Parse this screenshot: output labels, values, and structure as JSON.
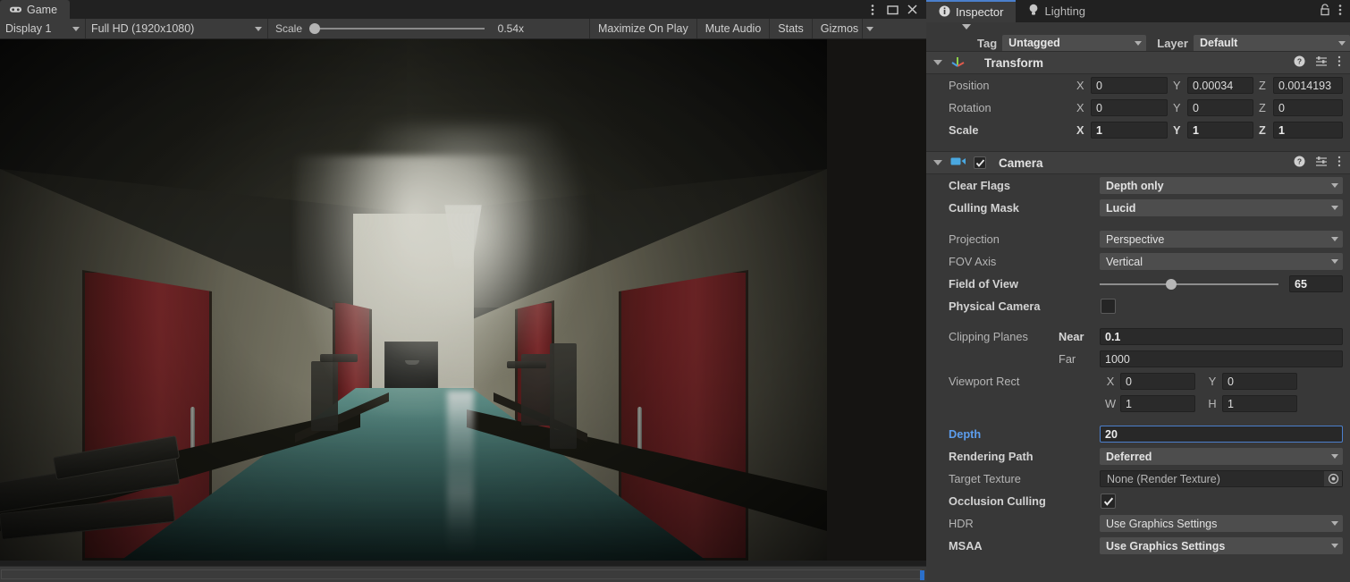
{
  "game_panel": {
    "tab": {
      "label": "Game",
      "icon": "gamepad-icon"
    },
    "window_buttons": [
      {
        "name": "kebab-menu-icon",
        "glyph": "⋮"
      },
      {
        "name": "maximize-icon",
        "glyph": "□"
      },
      {
        "name": "close-icon",
        "glyph": "✕"
      }
    ],
    "toolbar": {
      "display": "Display 1",
      "resolution": "Full HD (1920x1080)",
      "scale_label": "Scale",
      "scale_value": "0.54x",
      "maximize_on_play": "Maximize On Play",
      "mute_audio": "Mute Audio",
      "stats": "Stats",
      "gizmos": "Gizmos"
    }
  },
  "inspector": {
    "tabs": [
      {
        "label": "Inspector",
        "icon": "info-icon",
        "active": true
      },
      {
        "label": "Lighting",
        "icon": "lightbulb-icon",
        "active": false
      }
    ],
    "tab_icons": [
      {
        "name": "lock-icon",
        "glyph": "⏏"
      },
      {
        "name": "kebab-menu-icon",
        "glyph": "⋮"
      }
    ],
    "tag_label": "Tag",
    "tag_value": "Untagged",
    "layer_label": "Layer",
    "layer_value": "Default",
    "transform": {
      "title": "Transform",
      "icon": "transform-axis-icon",
      "rows": [
        {
          "label": "Position",
          "bold": false,
          "x": "0",
          "y": "0.00034",
          "z": "0.0014193"
        },
        {
          "label": "Rotation",
          "bold": false,
          "x": "0",
          "y": "0",
          "z": "0"
        },
        {
          "label": "Scale",
          "bold": true,
          "x": "1",
          "y": "1",
          "z": "1"
        }
      ],
      "axes": [
        "X",
        "Y",
        "Z"
      ]
    },
    "camera": {
      "title": "Camera",
      "icon": "camera-icon",
      "enabled": true,
      "clear_flags_label": "Clear Flags",
      "clear_flags_value": "Depth only",
      "culling_mask_label": "Culling Mask",
      "culling_mask_value": "Lucid",
      "projection_label": "Projection",
      "projection_value": "Perspective",
      "fov_axis_label": "FOV Axis",
      "fov_axis_value": "Vertical",
      "fov_label": "Field of View",
      "fov_value": "65",
      "physical_camera_label": "Physical Camera",
      "physical_camera_checked": false,
      "clipping_label": "Clipping Planes",
      "near_label": "Near",
      "near_value": "0.1",
      "far_label": "Far",
      "far_value": "1000",
      "viewport_label": "Viewport Rect",
      "viewport_x_label": "X",
      "viewport_x": "0",
      "viewport_y_label": "Y",
      "viewport_y": "0",
      "viewport_w_label": "W",
      "viewport_w": "1",
      "viewport_h_label": "H",
      "viewport_h": "1",
      "depth_label": "Depth",
      "depth_value": "20",
      "rendering_path_label": "Rendering Path",
      "rendering_path_value": "Deferred",
      "target_texture_label": "Target Texture",
      "target_texture_value": "None (Render Texture)",
      "occlusion_label": "Occlusion Culling",
      "occlusion_checked": true,
      "hdr_label": "HDR",
      "hdr_value": "Use Graphics Settings",
      "msaa_label": "MSAA",
      "msaa_value": "Use Graphics Settings"
    },
    "header_icons": [
      {
        "name": "help-icon",
        "glyph": "?"
      },
      {
        "name": "preset-icon",
        "glyph": "≡"
      },
      {
        "name": "kebab-menu-icon",
        "glyph": "⋮"
      }
    ]
  },
  "colors": {
    "accent_blue": "#4b7fcc",
    "panel_bg": "#383838",
    "tabbar_bg": "#212121",
    "field_bg": "#2a2a2a",
    "dropdown_bg": "#4d4d4d"
  }
}
